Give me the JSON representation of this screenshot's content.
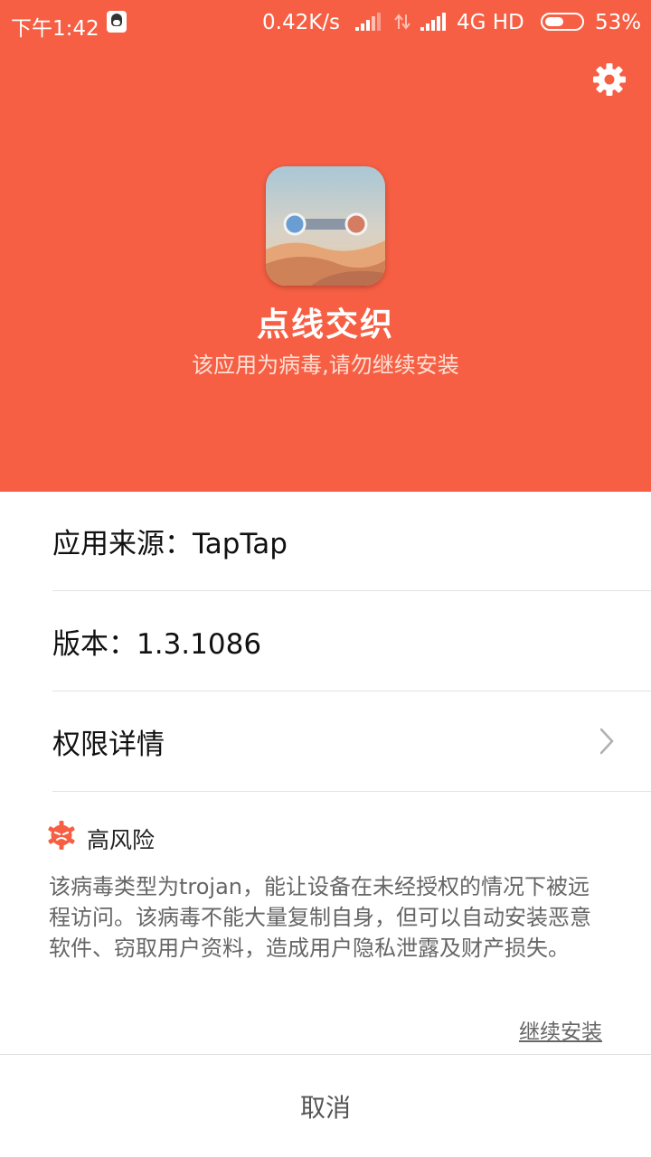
{
  "status_bar": {
    "time": "下午1:42",
    "speed": "0.42K/s",
    "network": "4G HD",
    "battery_percent": "53%",
    "battery_level": 0.53,
    "icons": [
      "qq-icon",
      "signal-icon",
      "data-transfer-icon",
      "signal-icon",
      "battery-icon"
    ]
  },
  "header": {
    "background_color": "#f65f43",
    "app_name": "点线交织",
    "warning": "该应用为病毒,请勿继续安装",
    "settings_icon": "gear-icon"
  },
  "info": {
    "source": "应用来源：TapTap",
    "version": "版本：1.3.1086",
    "permissions": "权限详情"
  },
  "risk": {
    "level": "高风险",
    "icon": "virus-icon",
    "icon_color": "#f65f43",
    "description": "该病毒类型为trojan，能让设备在未经授权的情况下被远程访问。该病毒不能大量复制自身，但可以自动安装恶意软件、窃取用户资料，造成用户隐私泄露及财产损失。"
  },
  "actions": {
    "continue_install": "继续安装",
    "cancel": "取消"
  }
}
